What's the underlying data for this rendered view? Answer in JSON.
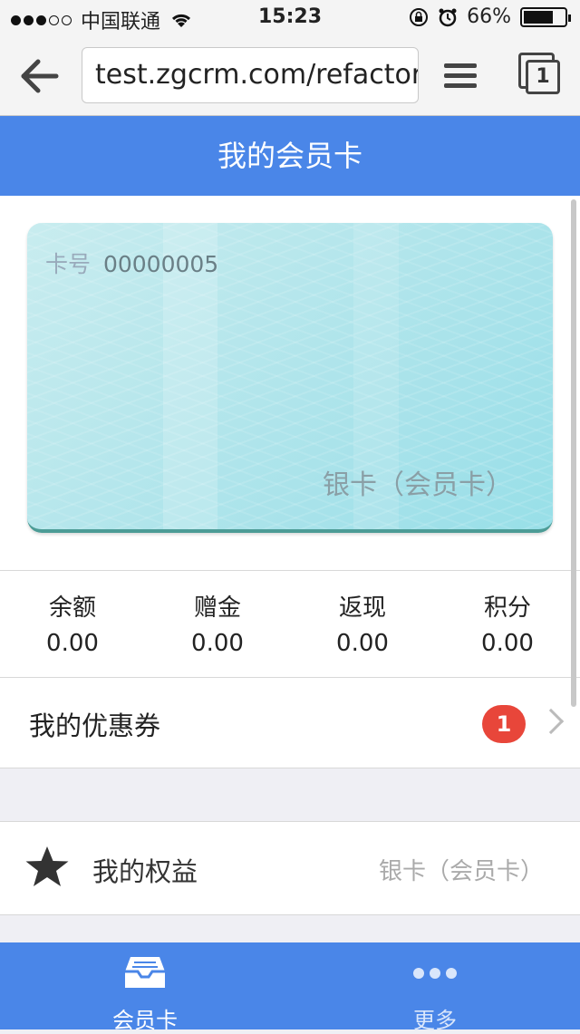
{
  "status_bar": {
    "carrier": "中国联通",
    "time": "15:23",
    "battery": "66%"
  },
  "browser": {
    "url": "test.zgcrm.com/refactor/",
    "tab_count": "1"
  },
  "header": {
    "title": "我的会员卡"
  },
  "card": {
    "number_label": "卡号",
    "number_value": "00000005",
    "type": "银卡（会员卡）"
  },
  "stats": [
    {
      "label": "余额",
      "value": "0.00"
    },
    {
      "label": "赠金",
      "value": "0.00"
    },
    {
      "label": "返现",
      "value": "0.00"
    },
    {
      "label": "积分",
      "value": "0.00"
    }
  ],
  "coupon": {
    "label": "我的优惠券",
    "badge": "1"
  },
  "rights": {
    "label": "我的权益",
    "value": "银卡（会员卡）",
    "icon": "star-icon"
  },
  "tabbar": [
    {
      "label": "会员卡",
      "icon": "member-card-icon",
      "active": true
    },
    {
      "label": "更多",
      "icon": "more-dots-icon",
      "active": false
    }
  ],
  "colors": {
    "primary": "#4a86e8",
    "badge": "#e8463a"
  }
}
